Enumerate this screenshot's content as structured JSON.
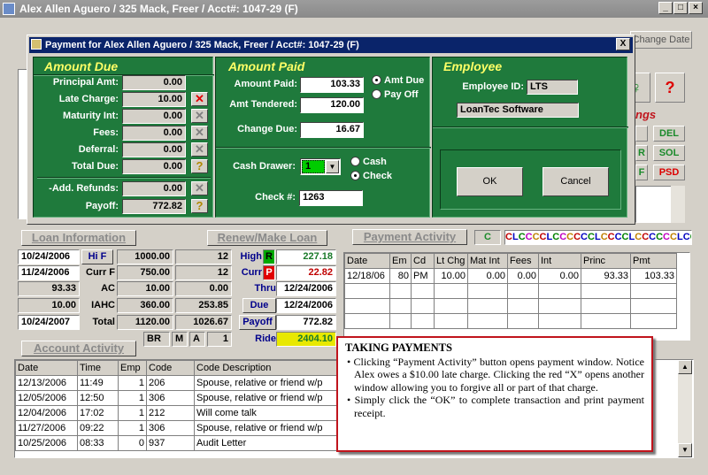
{
  "window": {
    "title": "Alex Allen Aguero / 325 Mack, Freer / Acct#: 1047-29 (F)",
    "change_date": "Change Date"
  },
  "dialog": {
    "title": "Payment for Alex Allen Aguero / 325 Mack, Freer / Acct#: 1047-29 (F)",
    "close": "X",
    "amount_due": {
      "heading": "Amount Due",
      "rows": [
        {
          "label": "Principal Amt:",
          "value": "0.00"
        },
        {
          "label": "Late Charge:",
          "value": "10.00"
        },
        {
          "label": "Maturity Int:",
          "value": "0.00"
        },
        {
          "label": "Fees:",
          "value": "0.00"
        },
        {
          "label": "Deferral:",
          "value": "0.00"
        },
        {
          "label": "Total Due:",
          "value": "0.00"
        }
      ],
      "add_refunds_label": "-Add. Refunds:",
      "add_refunds": "0.00",
      "payoff_label": "Payoff:",
      "payoff": "772.82"
    },
    "amount_paid": {
      "heading": "Amount Paid",
      "amount_paid_label": "Amount Paid:",
      "amount_paid": "103.33",
      "tendered_label": "Amt Tendered:",
      "tendered": "120.00",
      "change_label": "Change Due:",
      "change": "16.67",
      "opt_amt_due": "Amt Due",
      "opt_pay_off": "Pay Off",
      "drawer_label": "Cash Drawer:",
      "drawer": "1",
      "opt_cash": "Cash",
      "opt_check": "Check",
      "check_label": "Check #:",
      "check": "1263"
    },
    "employee": {
      "heading": "Employee",
      "id_label": "Employee ID:",
      "id": "LTS",
      "name": "LoanTec Software"
    },
    "ok": "OK",
    "cancel": "Cancel"
  },
  "side": {
    "ngs": "ngs",
    "del": "DEL",
    "sol": "SOL",
    "psd": "PSD",
    "r": "R",
    "f": "F",
    "question": "?"
  },
  "loan_info": {
    "tab": "Loan Information",
    "renew_tab": "Renew/Make Loan",
    "col1": [
      "10/24/2006",
      "11/24/2006",
      "93.33",
      "10.00",
      "10/24/2007"
    ],
    "labels": [
      "Hi F",
      "Curr F",
      "AC",
      "IAHC",
      "Total"
    ],
    "col2": [
      "1000.00",
      "750.00",
      "10.00",
      "360.00",
      "1120.00"
    ],
    "col3": [
      "12",
      "12",
      "0.00",
      "253.85",
      "1026.67"
    ],
    "right_labels": [
      "High",
      "Curr",
      "Thru",
      "Due",
      "Payoff",
      "Ride"
    ],
    "right_flags": [
      "R",
      "P"
    ],
    "right_values": [
      "227.18",
      "22.82",
      "12/24/2006",
      "12/24/2006",
      "772.82",
      "2404.10"
    ],
    "bottom": [
      "BR",
      "M",
      "A",
      "1"
    ]
  },
  "payment_activity": {
    "tab": "Payment Activity",
    "c_label": "C",
    "ticker": "CLCCCCLCCCCCCLCCCCLCCCCCCLCCCC",
    "headers": [
      "Date",
      "Em",
      "Cd",
      "Lt Chg",
      "Mat Int",
      "Fees",
      "Int",
      "Princ",
      "Pmt"
    ],
    "row": [
      "12/18/06",
      "80",
      "PM",
      "10.00",
      "0.00",
      "0.00",
      "0.00",
      "93.33",
      "103.33"
    ]
  },
  "account_activity": {
    "tab": "Account Activity",
    "headers": [
      "Date",
      "Time",
      "Emp",
      "Code",
      "Code Description"
    ],
    "rows": [
      [
        "12/13/2006",
        "11:49",
        "1",
        "206",
        "Spouse, relative or friend w/p"
      ],
      [
        "12/05/2006",
        "12:50",
        "1",
        "306",
        "Spouse, relative or friend w/p"
      ],
      [
        "12/04/2006",
        "17:02",
        "1",
        "212",
        "Will come talk"
      ],
      [
        "11/27/2006",
        "09:22",
        "1",
        "306",
        "Spouse, relative or friend w/p"
      ],
      [
        "10/25/2006",
        "08:33",
        "0",
        "937",
        "Audit Letter"
      ]
    ]
  },
  "callout": {
    "title": "TAKING PAYMENTS",
    "bullets": [
      "Clicking “Payment Activity” button opens payment window. Notice Alex owes a $10.00 late charge. Clicking the red “X” opens another window allowing you to forgive all or part of that charge.",
      "Simply click the “OK” to complete transaction and print payment receipt."
    ]
  },
  "colors": {
    "dialog_green": "#1f7a3c",
    "heading_yellow": "#ffff66",
    "title_blue": "#0a246a",
    "callout_border": "#c0141c"
  }
}
